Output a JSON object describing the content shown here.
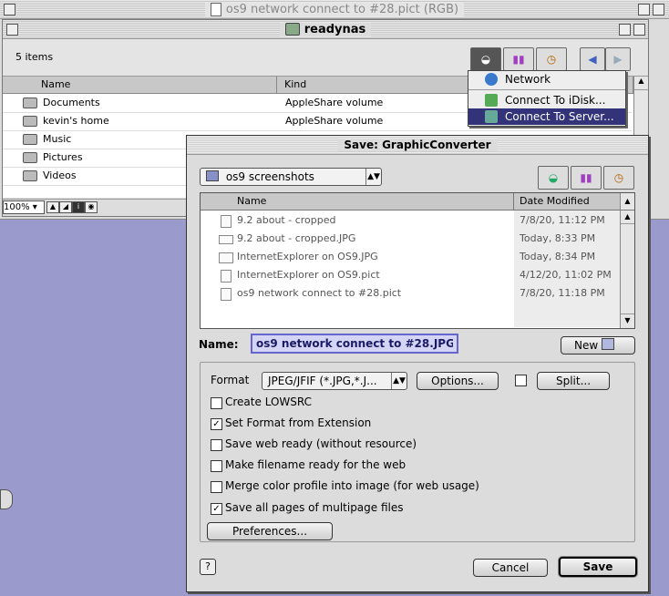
{
  "outer_window": {
    "title": "os9 network connect to #28.pict (RGB)"
  },
  "finder": {
    "title": "readynas",
    "item_count": "5 items",
    "columns": {
      "name": "Name",
      "kind": "Kind"
    },
    "rows": [
      {
        "name": "Documents",
        "kind": "AppleShare volume"
      },
      {
        "name": "kevin's home",
        "kind": "AppleShare volume"
      },
      {
        "name": "Music",
        "kind": ""
      },
      {
        "name": "Pictures",
        "kind": ""
      },
      {
        "name": "Videos",
        "kind": ""
      }
    ],
    "zoom": "100%"
  },
  "network_menu": {
    "items": [
      {
        "label": "Network",
        "icon": "globe-icon",
        "selected": false
      },
      {
        "label": "Connect To iDisk...",
        "icon": "idisk-icon",
        "selected": false
      },
      {
        "label": "Connect To Server...",
        "icon": "server-icon",
        "selected": true
      }
    ]
  },
  "save_dialog": {
    "title": "Save: GraphicConverter",
    "folder_popup": "os9 screenshots",
    "columns": {
      "name": "Name",
      "date": "Date Modified"
    },
    "files": [
      {
        "name": "9.2 about - cropped",
        "date": "7/8/20, 11:12 PM"
      },
      {
        "name": "9.2 about - cropped.JPG",
        "date": "Today, 8:33 PM"
      },
      {
        "name": "InternetExplorer on OS9.JPG",
        "date": "Today, 8:34 PM"
      },
      {
        "name": "InternetExplorer on OS9.pict",
        "date": "4/12/20, 11:02 PM"
      },
      {
        "name": "os9 network connect to #28.pict",
        "date": "7/8/20, 11:18 PM"
      }
    ],
    "name_label": "Name:",
    "name_value": "os9 network connect to #28.JPG",
    "new_button": "New",
    "format_label": "Format",
    "format_value": "JPEG/JFIF (*.JPG,*.J...",
    "options_button": "Options...",
    "split_button": "Split...",
    "checkboxes": [
      {
        "label": "Create LOWSRC",
        "checked": false
      },
      {
        "label": "Set Format from Extension",
        "checked": true
      },
      {
        "label": "Save web ready (without resource)",
        "checked": false
      },
      {
        "label": "Make filename ready for the web",
        "checked": false
      },
      {
        "label": "Merge color profile into image (for web usage)",
        "checked": false
      },
      {
        "label": "Save all pages of multipage files",
        "checked": true
      }
    ],
    "preferences_button": "Preferences...",
    "help_icon": "?",
    "cancel_button": "Cancel",
    "save_button": "Save"
  },
  "colors": {
    "desktop": "#9a9acc",
    "menu_highlight": "#33337a",
    "window": "#dcdcdc"
  }
}
